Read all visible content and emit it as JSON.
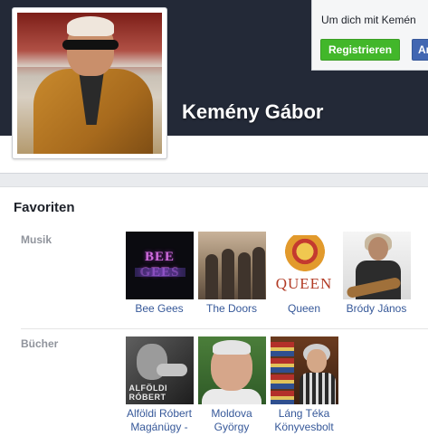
{
  "profile": {
    "name": "Kemény Gábor"
  },
  "signup": {
    "prompt_text": "Um dich mit Kemén",
    "register_label": "Registrieren",
    "login_label": "An"
  },
  "favorites": {
    "title": "Favoriten",
    "categories": [
      {
        "label": "Musik",
        "items": [
          {
            "name": "Bee Gees",
            "thumb_text": "BEE GEES"
          },
          {
            "name": "The Doors"
          },
          {
            "name": "Queen",
            "thumb_text": "QUEEN"
          },
          {
            "name": "Bródy János"
          }
        ]
      },
      {
        "label": "Bücher",
        "items": [
          {
            "name": "Alföldi Róbert Magánügy -",
            "thumb_text": "ALFÖLDI RÓBERT"
          },
          {
            "name": "Moldova György"
          },
          {
            "name": "Láng Téka Könyvesbolt"
          }
        ]
      }
    ]
  }
}
